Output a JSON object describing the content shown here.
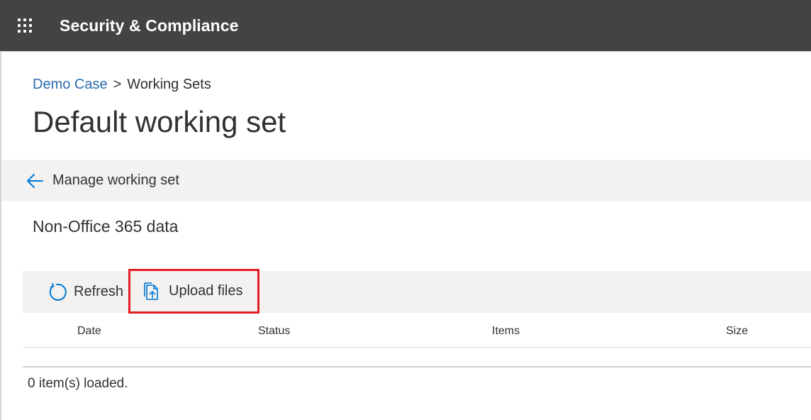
{
  "app": {
    "title": "Security & Compliance",
    "waffle_icon": "app-launcher-icon"
  },
  "breadcrumb": {
    "parent": "Demo Case",
    "separator": ">",
    "current": "Working Sets"
  },
  "page": {
    "title": "Default working set"
  },
  "manage_bar": {
    "back_icon": "back-arrow-icon",
    "label": "Manage working set"
  },
  "section": {
    "title": "Non-Office 365 data"
  },
  "toolbar": {
    "refresh_label": "Refresh",
    "refresh_icon": "refresh-icon",
    "upload_label": "Upload files",
    "upload_icon": "upload-files-icon"
  },
  "table": {
    "columns": [
      "Date",
      "Status",
      "Items",
      "Size"
    ],
    "rows": []
  },
  "status": {
    "text": "0 item(s) loaded."
  },
  "colors": {
    "topbar": "#454341",
    "link": "#2b6cae",
    "accent_icon": "#0078d4",
    "highlight_border": "#e31c23",
    "bar_background": "#f3f2f1"
  }
}
